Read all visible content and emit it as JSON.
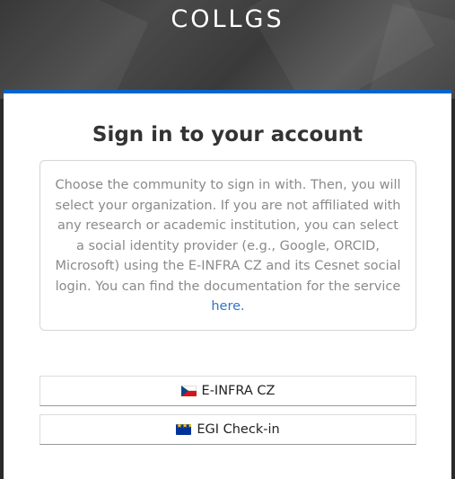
{
  "header": {
    "brand": "COLLGS"
  },
  "login": {
    "title": "Sign in to your account",
    "info_text": "Choose the community to sign in with. Then, you will select your organization. If you are not affiliated with any research or academic institution, you can select a social identity provider (e.g., Google, ORCID, Microsoft) using the E-INFRA CZ and its Cesnet social login. You can find the documentation for the service ",
    "info_link": "here.",
    "providers": [
      {
        "label": "E-INFRA CZ",
        "icon": "czech-flag-icon"
      },
      {
        "label": "EGI Check-in",
        "icon": "eu-flag-icon"
      }
    ]
  },
  "colors": {
    "accent": "#0066cc",
    "link": "#2e77c6",
    "header_bg": "#3a3a3a"
  }
}
